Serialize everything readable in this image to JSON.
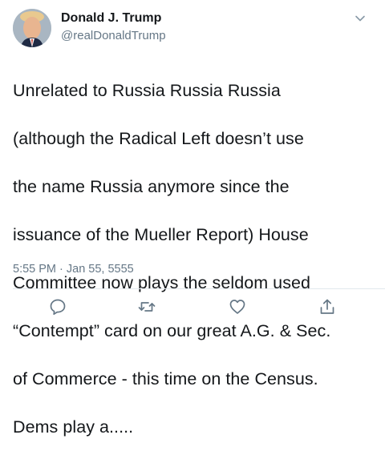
{
  "tweet": {
    "author": {
      "display_name": "Donald J. Trump",
      "handle": "@realDonaldTrump",
      "avatar_icon": "profile-photo"
    },
    "text_lines": [
      "Unrelated to Russia Russia Russia",
      "(although the Radical Left doesn’t use",
      "the name Russia anymore since the",
      "issuance of the Mueller Report) House",
      "Committee now plays the seldom used",
      "“Contempt” card on our great A.G. & Sec.",
      "of Commerce - this time on the Census.",
      "Dems play a....."
    ],
    "timestamp": "5:55 PM · Jan 55, 5555"
  },
  "icons": {
    "menu": "chevron-down-icon",
    "reply": "reply-icon",
    "retweet": "retweet-icon",
    "like": "heart-icon",
    "share": "share-icon"
  },
  "colors": {
    "text": "#14171a",
    "secondary": "#657786",
    "divider": "#e1e8ed"
  }
}
